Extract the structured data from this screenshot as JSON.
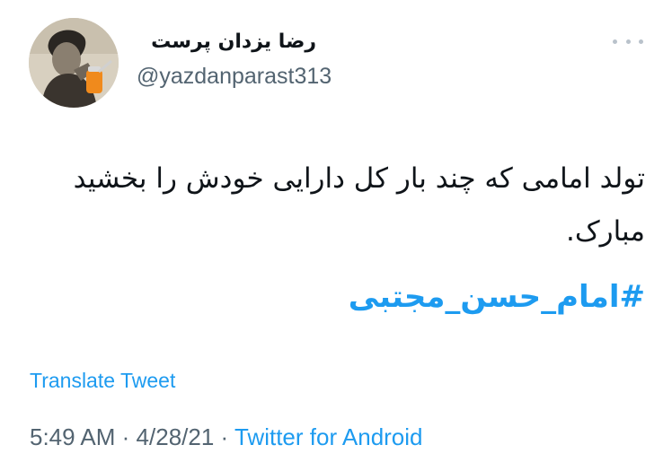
{
  "tweet": {
    "author": {
      "display_name": "رضا یزدان پرست",
      "handle": "@yazdanparast313",
      "avatar": "photo-avatar"
    },
    "more_icon": "more-horizontal-icon",
    "text": "تولد امامی که چند بار کل دارایی خودش را بخشید مبارک.",
    "hashtag": "#امام_حسن_مجتبی",
    "translate_label": "Translate Tweet",
    "time": "5:49 AM",
    "separator": "·",
    "date": "4/28/21",
    "source": "Twitter for Android"
  },
  "colors": {
    "link": "#1d9bf0",
    "secondary_text": "#536471",
    "primary_text": "#0f1419"
  }
}
